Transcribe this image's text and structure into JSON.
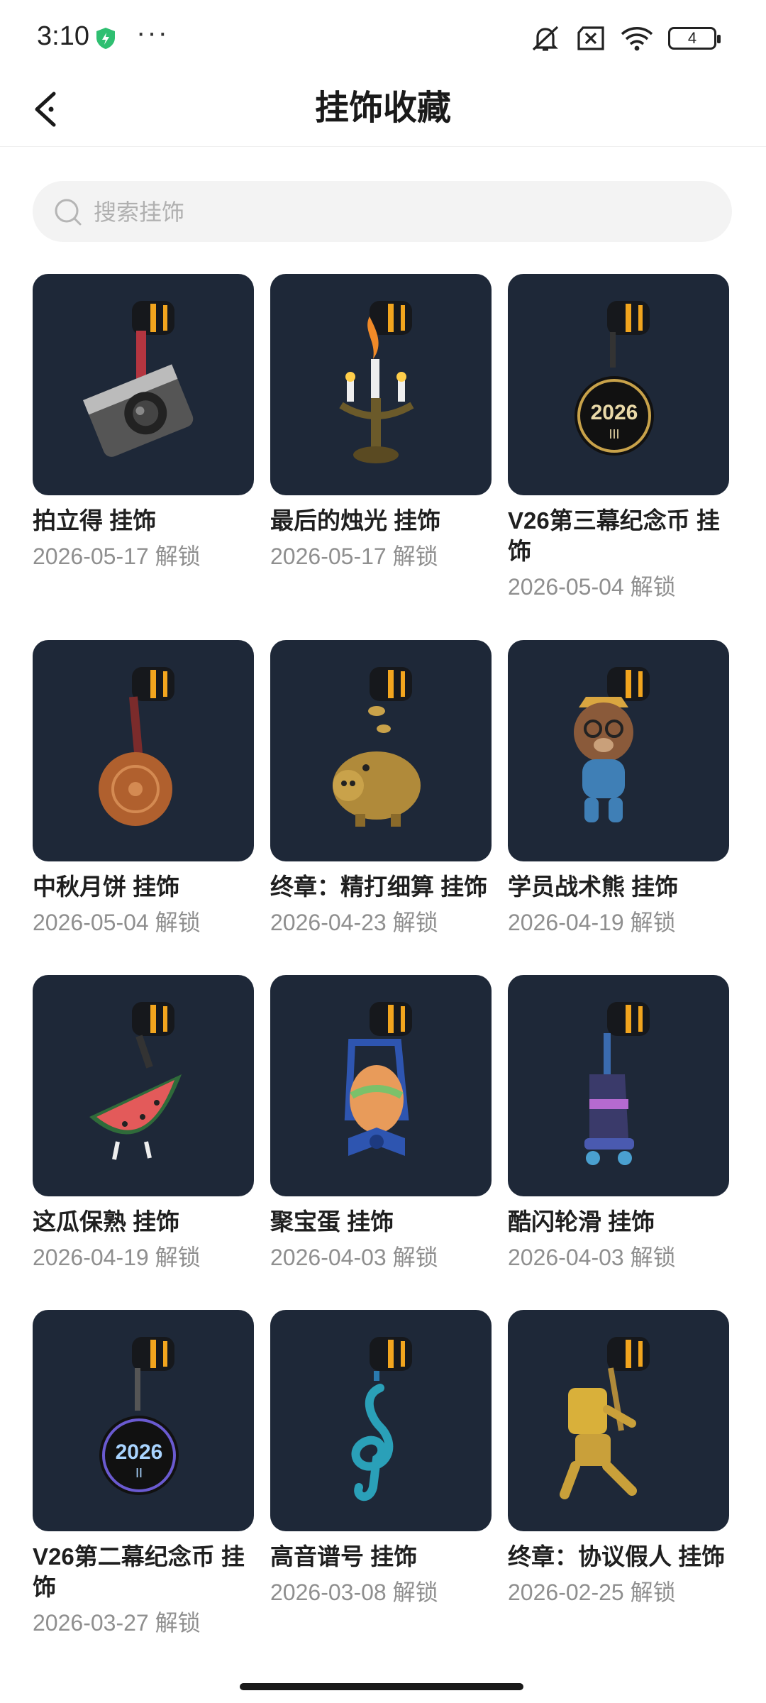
{
  "status_bar": {
    "time": "3:10",
    "battery_level": "4",
    "icons": [
      "shield-icon",
      "more-icon",
      "mute-icon",
      "no-sim-icon",
      "wifi-icon",
      "battery-icon"
    ],
    "shield_color": "#2fbf71"
  },
  "header": {
    "title": "挂饰收藏",
    "back_icon": "back-arrow-icon"
  },
  "search": {
    "placeholder": "搜索挂饰",
    "value": ""
  },
  "colors": {
    "thumb_bg": "#1e2838",
    "date_text": "#8f8f8f"
  },
  "items": [
    {
      "name": "拍立得 挂饰",
      "date": "2026-05-17 解锁",
      "icon": "camera-charm-icon"
    },
    {
      "name": "最后的烛光 挂饰",
      "date": "2026-05-17 解锁",
      "icon": "candelabra-charm-icon"
    },
    {
      "name": "V26第三幕纪念币 挂饰",
      "date": "2026-05-04 解锁",
      "icon": "coin-2026-iii-charm-icon"
    },
    {
      "name": "中秋月饼 挂饰",
      "date": "2026-05-04 解锁",
      "icon": "mooncake-charm-icon"
    },
    {
      "name": "终章：精打细算 挂饰",
      "date": "2026-04-23 解锁",
      "icon": "piggy-bank-charm-icon"
    },
    {
      "name": "学员战术熊 挂饰",
      "date": "2026-04-19 解锁",
      "icon": "bear-charm-icon"
    },
    {
      "name": "这瓜保熟 挂饰",
      "date": "2026-04-19 解锁",
      "icon": "watermelon-charm-icon"
    },
    {
      "name": "聚宝蛋 挂饰",
      "date": "2026-04-03 解锁",
      "icon": "egg-charm-icon"
    },
    {
      "name": "酷闪轮滑 挂饰",
      "date": "2026-04-03 解锁",
      "icon": "roller-skate-charm-icon"
    },
    {
      "name": "V26第二幕纪念币 挂饰",
      "date": "2026-03-27 解锁",
      "icon": "coin-2026-ii-charm-icon"
    },
    {
      "name": "高音谱号 挂饰",
      "date": "2026-03-08 解锁",
      "icon": "treble-clef-charm-icon"
    },
    {
      "name": "终章：协议假人 挂饰",
      "date": "2026-02-25 解锁",
      "icon": "robot-dummy-charm-icon"
    }
  ],
  "coin_labels": {
    "coin_year": "2026",
    "act_iii": "III",
    "act_ii": "II"
  }
}
